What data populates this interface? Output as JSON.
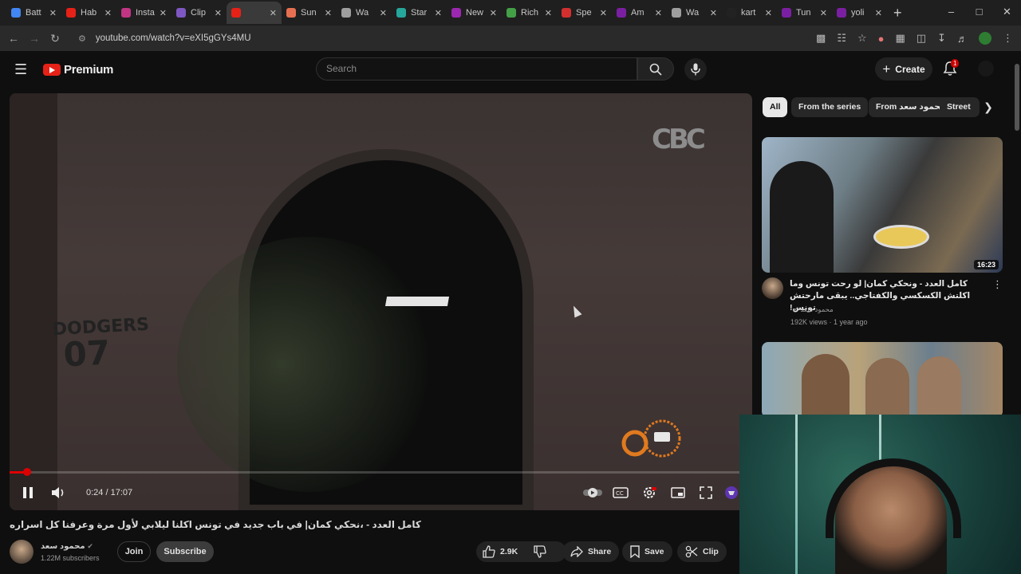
{
  "browser": {
    "tabs": [
      {
        "label": "Batt",
        "color": "#4285f4"
      },
      {
        "label": "Hab",
        "color": "#e62117"
      },
      {
        "label": "Insta",
        "color": "#c13584"
      },
      {
        "label": "Clip",
        "color": "#7e57c2"
      },
      {
        "label": "",
        "color": "#e62117",
        "active": true
      },
      {
        "label": "Sun",
        "color": "#e76f51"
      },
      {
        "label": "Wa",
        "color": "#9e9e9e"
      },
      {
        "label": "Star",
        "color": "#26a69a"
      },
      {
        "label": "New",
        "color": "#9c27b0"
      },
      {
        "label": "Rich",
        "color": "#43a047"
      },
      {
        "label": "Spe",
        "color": "#d32f2f"
      },
      {
        "label": "Am",
        "color": "#7b1fa2"
      },
      {
        "label": "Wa",
        "color": "#9e9e9e"
      },
      {
        "label": "kart",
        "color": "#222222"
      },
      {
        "label": "Tun",
        "color": "#7b1fa2"
      },
      {
        "label": "yoli",
        "color": "#7b1fa2"
      }
    ],
    "new_tab": "+",
    "url": "youtube.com/watch?v=eXI5gGYs4MU"
  },
  "youtube": {
    "logo_text": "Premium",
    "search_placeholder": "Search",
    "create_label": "Create",
    "notification_count": "1"
  },
  "player": {
    "time": "0:24 / 17:07",
    "progress_fraction": 0.0234,
    "overlay_text": "DODGERS",
    "overlay_number": "07",
    "watermark": "CBC"
  },
  "video": {
    "title": "كامل العدد - ،نحكي كمان| في باب جديد في تونس اكلنا ليلابي لأول مرة وعرفنا كل اسراره",
    "channel": "محمود سعد",
    "subscribers": "1.22M subscribers",
    "join_label": "Join",
    "subscribe_label": "Subscribe",
    "likes": "2.9K",
    "share_label": "Share",
    "save_label": "Save",
    "clip_label": "Clip"
  },
  "sidebar": {
    "chips": [
      "All",
      "From the series",
      "From محمود سعد",
      "Street"
    ],
    "videos": [
      {
        "title": "كامل العدد - ونحكي كمان| لو رحت تونس وما اكلتش الكسكسي والكفتاجي.. يبقى مارحتش تونس!",
        "channel": "محمود سعد",
        "meta": "192K views · 1 year ago",
        "duration": "16:23"
      }
    ]
  }
}
